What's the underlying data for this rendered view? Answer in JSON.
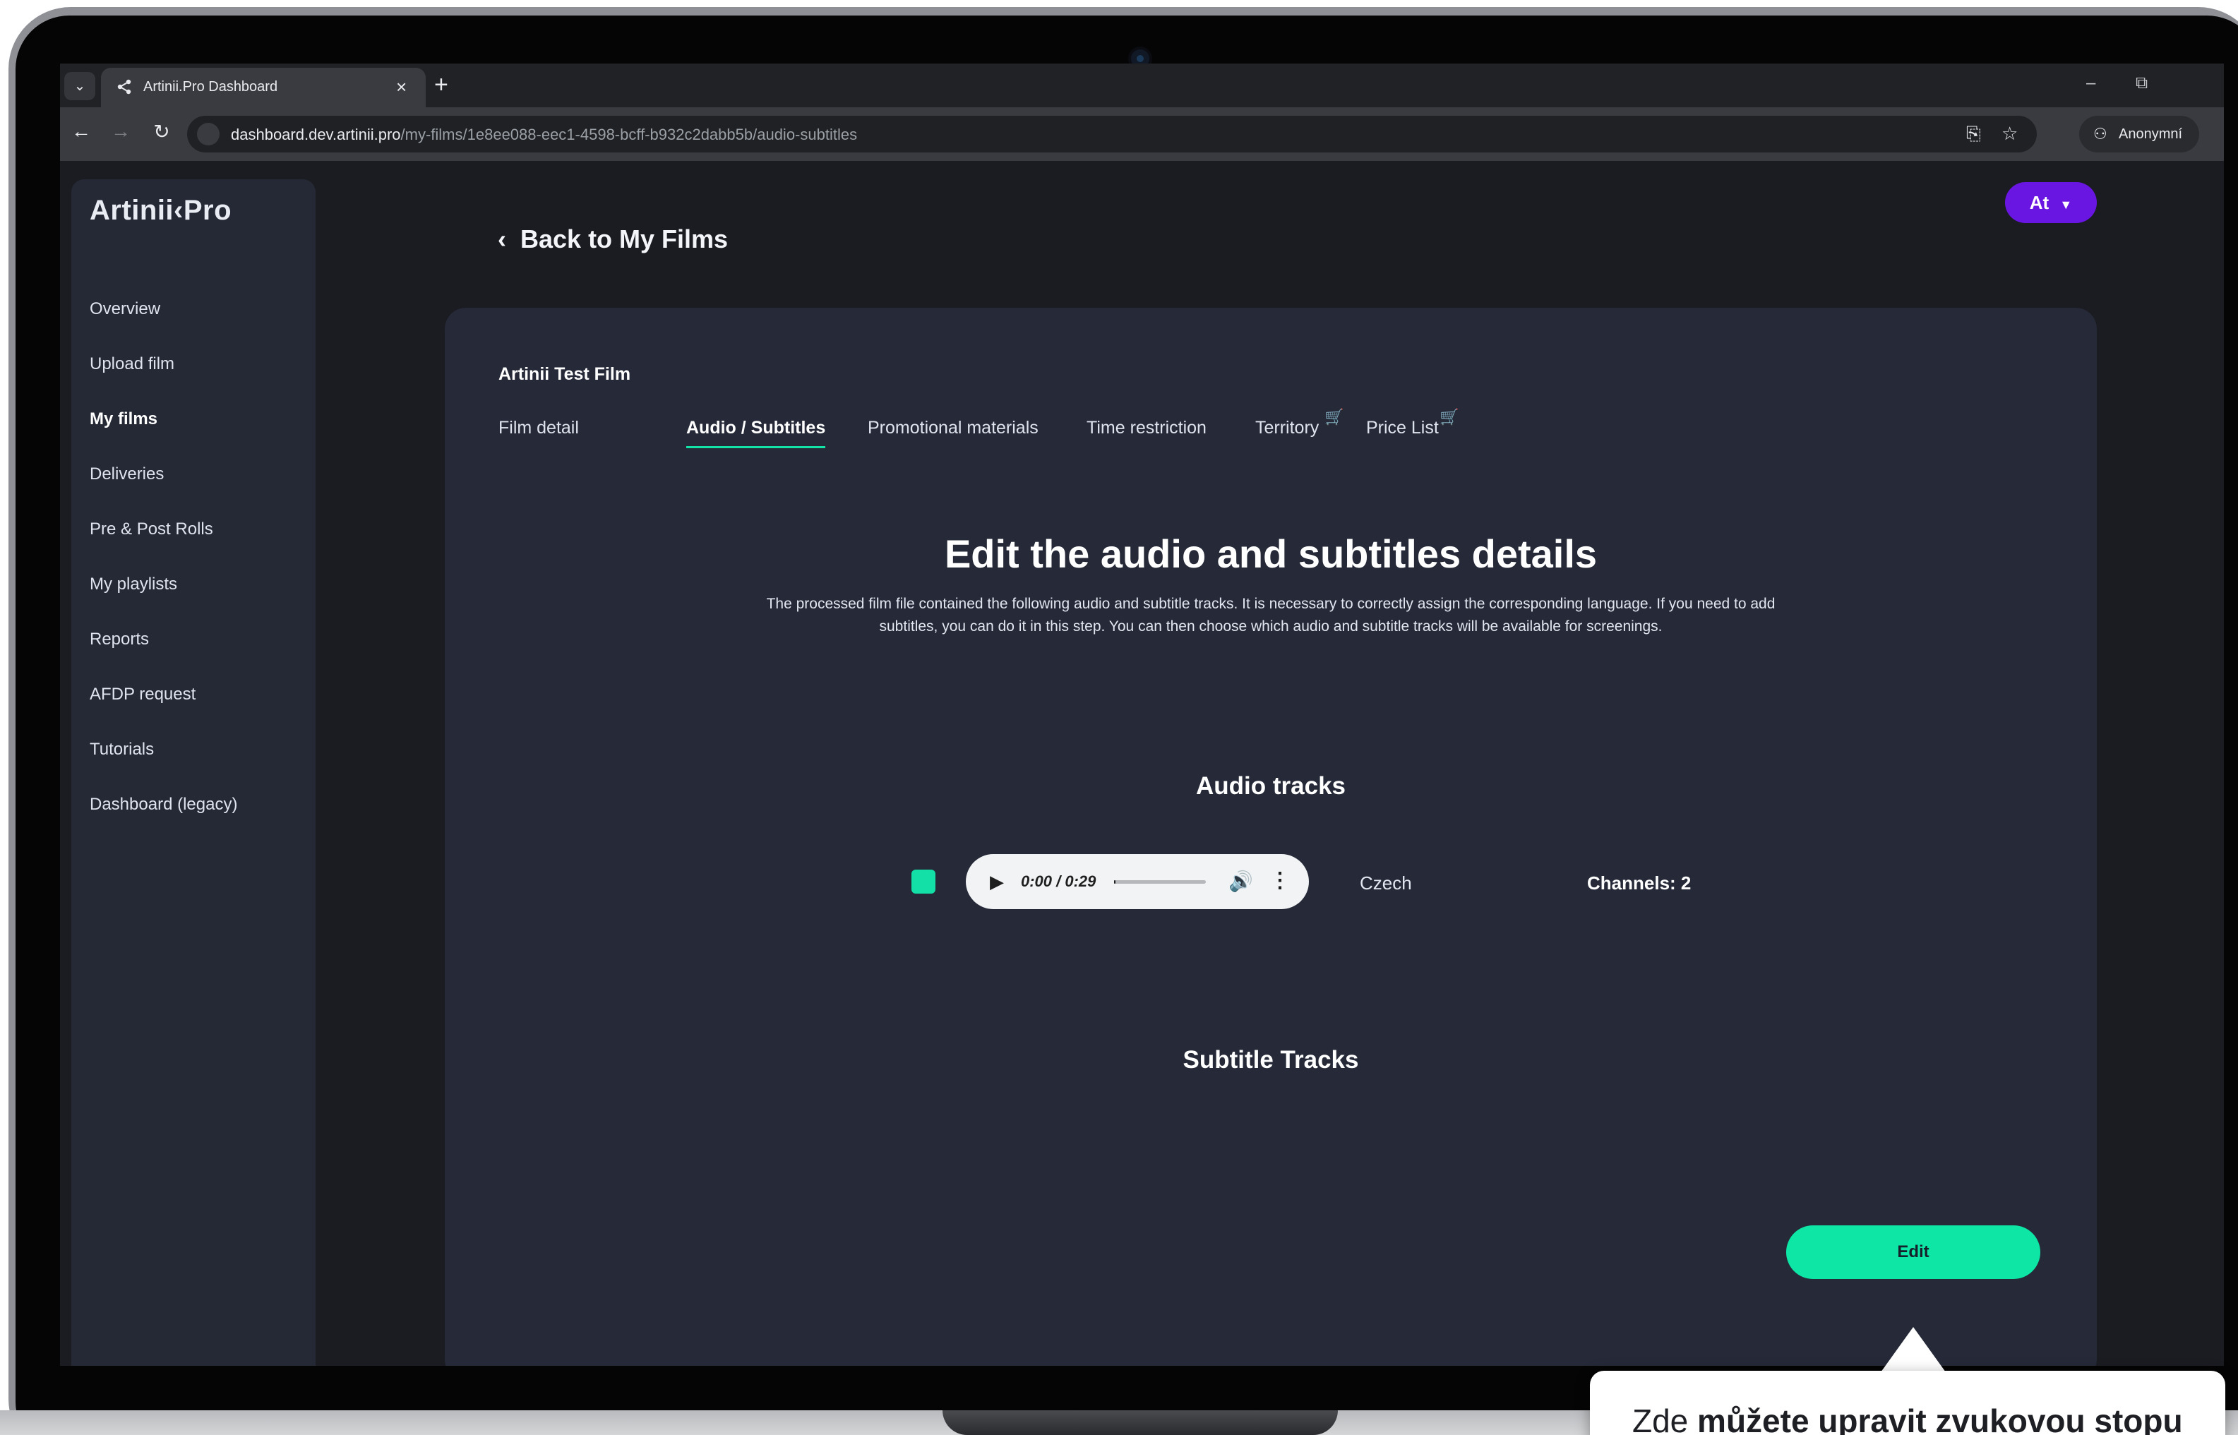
{
  "browser": {
    "tab_title": "Artinii.Pro Dashboard",
    "url_host": "dashboard.dev.artinii.pro",
    "url_path": "/my-films/1e8ee088-eec1-4598-bcff-b932c2dabb5b/audio-subtitles",
    "profile_label": "Anonymní"
  },
  "sidebar": {
    "logo": "Artinii‹Pro",
    "items": [
      {
        "label": "Overview"
      },
      {
        "label": "Upload film"
      },
      {
        "label": "My films",
        "active": true
      },
      {
        "label": "Deliveries"
      },
      {
        "label": "Pre & Post Rolls"
      },
      {
        "label": "My playlists"
      },
      {
        "label": "Reports"
      },
      {
        "label": "AFDP request"
      },
      {
        "label": "Tutorials"
      },
      {
        "label": "Dashboard (legacy)"
      }
    ]
  },
  "header": {
    "user_initials": "At",
    "back_label": "Back to My Films"
  },
  "film": {
    "title": "Artinii Test Film",
    "tabs": [
      {
        "label": "Film detail"
      },
      {
        "label": "Audio / Subtitles",
        "active": true
      },
      {
        "label": "Promotional materials"
      },
      {
        "label": "Time restriction"
      },
      {
        "label": "Territory",
        "cart": true
      },
      {
        "label": "Price List",
        "cart": true
      }
    ]
  },
  "main": {
    "heading": "Edit the audio and subtitles details",
    "description_line1": "The processed film file contained the following audio and subtitle tracks. It is necessary to correctly assign the corresponding language. If you need to add",
    "description_line2": "subtitles, you can do it in this step. You can then choose which audio and subtitle tracks will be available for screenings.",
    "audio_heading": "Audio tracks",
    "subtitle_heading": "Subtitle Tracks",
    "edit_label": "Edit"
  },
  "audio_tracks": [
    {
      "time": "0:00 / 0:29",
      "progress": 0.0,
      "language": "Czech",
      "channels": "Channels: 2"
    }
  ],
  "tooltip": {
    "text_prefix": "Zde ",
    "text_bold": "můžete upravit zvukovou stopu"
  },
  "colors": {
    "accent": "#0ee6a6",
    "user_button": "#6a16e2",
    "card": "#252938",
    "sidebar": "#252936"
  }
}
